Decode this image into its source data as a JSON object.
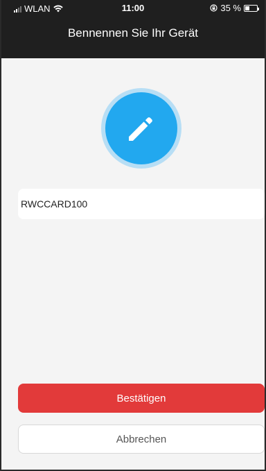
{
  "status_bar": {
    "carrier": "WLAN",
    "time": "11:00",
    "battery": "35 %",
    "battery_level": 0.35
  },
  "header": {
    "title": "Bennennen Sie Ihr Gerät"
  },
  "icons": {
    "edit": "pencil-icon",
    "wifi": "wifi-icon",
    "lock": "rotation-lock-icon",
    "battery": "battery-icon"
  },
  "colors": {
    "header_bg": "#1f1f1f",
    "accent_blue": "#22a8ef",
    "confirm_red": "#e23a3a"
  },
  "form": {
    "device_name_value": "RWCCARD100"
  },
  "actions": {
    "confirm_label": "Bestätigen",
    "cancel_label": "Abbrechen"
  }
}
